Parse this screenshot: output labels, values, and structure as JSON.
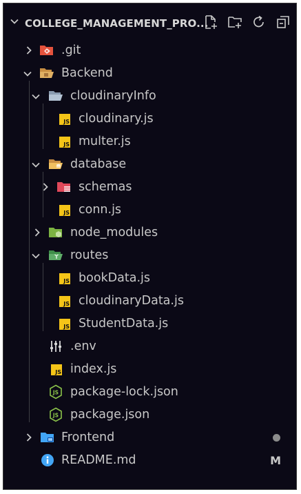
{
  "explorer": {
    "title": "COLLEGE_MANAGEMENT_PRO...",
    "actions": [
      {
        "name": "new-file-button",
        "icon": "new-file-icon"
      },
      {
        "name": "new-folder-button",
        "icon": "new-folder-icon"
      },
      {
        "name": "refresh-button",
        "icon": "refresh-icon"
      },
      {
        "name": "collapse-all-button",
        "icon": "collapse-all-icon"
      }
    ]
  },
  "tree": {
    "git": ".git",
    "backend": "Backend",
    "cloudinaryInfo": "cloudinaryInfo",
    "cloudinary_js": "cloudinary.js",
    "multer_js": "multer.js",
    "database": "database",
    "schemas": "schemas",
    "conn_js": "conn.js",
    "node_modules": "node_modules",
    "routes": "routes",
    "bookData_js": "bookData.js",
    "cloudinaryData_js": "cloudinaryData.js",
    "studentData_js": "StudentData.js",
    "env": ".env",
    "index_js": "index.js",
    "package_lock": "package-lock.json",
    "package_json": "package.json",
    "frontend": "Frontend",
    "readme": "README.md",
    "readme_badge": "M",
    "js_badge": "JS"
  },
  "colors": {
    "background": "#0b0916",
    "text": "#c8c8c8",
    "js_yellow": "#f5c518",
    "folder_tan": "#d6a35a",
    "git_orange": "#e5533d",
    "node_green": "#8bc34a",
    "frontend_blue": "#42a5f5"
  }
}
